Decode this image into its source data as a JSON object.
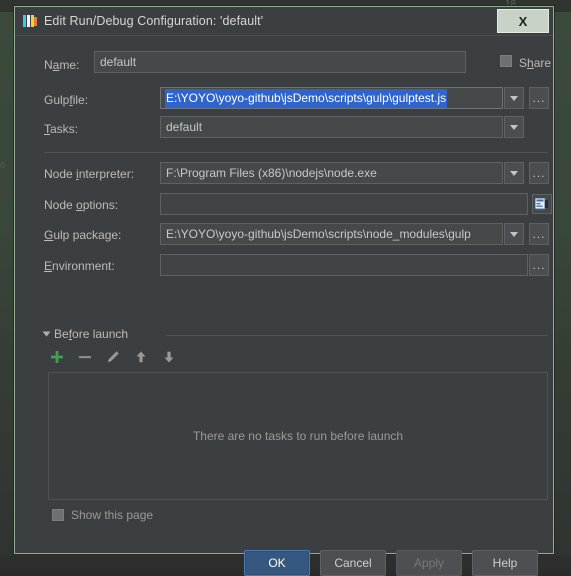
{
  "background": {
    "corner_number": "18",
    "left_marker": "o"
  },
  "dialog": {
    "title": "Edit Run/Debug Configuration: 'default'",
    "app_icon": "webstorm-icon",
    "close_label": "X"
  },
  "form": {
    "name": {
      "label_pre": "N",
      "label_mnemonic": "a",
      "label_post": "me:",
      "label_full": "Name:",
      "value": "default",
      "placeholder": ""
    },
    "share": {
      "label_pre": "S",
      "label_mnemonic": "h",
      "label_post": "are",
      "label_full": "Share",
      "checked": false
    },
    "gulpfile": {
      "label_pre": "Gulp",
      "label_mnemonic": "f",
      "label_post": "ile:",
      "label_full": "Gulpfile:",
      "value": "E:\\YOYO\\yoyo-github\\jsDemo\\scripts\\gulp\\gulptest.js",
      "selected": true,
      "has_dropdown": true,
      "has_browse": true
    },
    "tasks": {
      "label_pre": "",
      "label_mnemonic": "T",
      "label_post": "asks:",
      "label_full": "Tasks:",
      "value": "default",
      "has_dropdown": true,
      "has_browse": false
    },
    "node_interpreter": {
      "label_pre": "Node ",
      "label_mnemonic": "i",
      "label_post": "nterpreter:",
      "label_full": "Node interpreter:",
      "value": "F:\\Program Files (x86)\\nodejs\\node.exe",
      "has_dropdown": true,
      "has_browse": true
    },
    "node_options": {
      "label_pre": "Node ",
      "label_mnemonic": "o",
      "label_post": "ptions:",
      "label_full": "Node options:",
      "value": "",
      "expand_icon": "expand-editor-icon"
    },
    "gulp_package": {
      "label_pre": "",
      "label_mnemonic": "G",
      "label_post": "ulp package:",
      "label_full": "Gulp package:",
      "value": "E:\\YOYO\\yoyo-github\\jsDemo\\scripts\\node_modules\\gulp",
      "has_dropdown": true,
      "has_browse": true
    },
    "environment": {
      "label_pre": "",
      "label_mnemonic": "E",
      "label_post": "nvironment:",
      "label_full": "Environment:",
      "value": "",
      "has_browse": true
    }
  },
  "before_launch": {
    "title_pre": "Be",
    "title_mnemonic": "f",
    "title_post": "ore launch",
    "title_full": "Before launch",
    "expanded": true,
    "toolbar": [
      {
        "name": "add-task-button",
        "glyph": "+"
      },
      {
        "name": "remove-task-button",
        "glyph": "−"
      },
      {
        "name": "edit-task-button",
        "glyph": "✎"
      },
      {
        "name": "move-up-button",
        "glyph": "↑"
      },
      {
        "name": "move-down-button",
        "glyph": "↓"
      }
    ],
    "empty_text": "There are no tasks to run before launch",
    "tasks": []
  },
  "show_this_page": {
    "label": "Show this page",
    "checked": false
  },
  "buttons": [
    {
      "name": "ok-button",
      "label": "OK",
      "state": "primary"
    },
    {
      "name": "cancel-button",
      "label": "Cancel",
      "state": "normal"
    },
    {
      "name": "apply-button",
      "label": "Apply",
      "state": "disabled"
    },
    {
      "name": "help-button",
      "label": "Help",
      "state": "normal"
    }
  ],
  "colors": {
    "dialog_bg": "#3c3f41",
    "field_bg": "#45494a",
    "selection_blue": "#2f65ca",
    "primary_button": "#365880",
    "accent_green_border": "#93ad93",
    "add_icon_green": "#499c54"
  }
}
